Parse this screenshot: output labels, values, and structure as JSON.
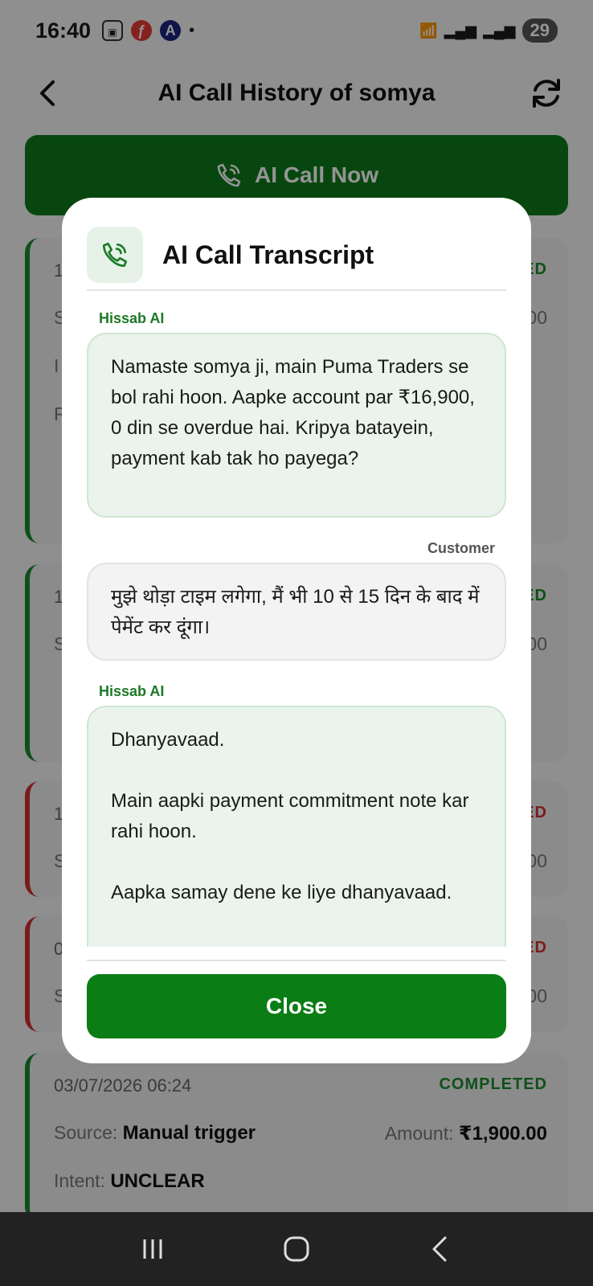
{
  "status_bar": {
    "time": "16:40",
    "battery": "29"
  },
  "header": {
    "title": "AI Call History of somya"
  },
  "call_now": {
    "label": "AI Call Now"
  },
  "cards": [
    {
      "date": "1",
      "status": "ED",
      "source_initial": "S",
      "amount_tail": "00",
      "intent_initial": "I",
      "extra_initial": "R"
    },
    {
      "date": "1",
      "status": "ED",
      "source_initial": "S",
      "amount_tail": "00"
    },
    {
      "date": "1",
      "status": "ED",
      "source_initial": "S",
      "amount_tail": "00"
    },
    {
      "date": "0",
      "status": "ED",
      "source_initial": "S",
      "amount_tail": "00"
    },
    {
      "date": "03/07/2026 06:24",
      "status": "COMPLETED",
      "source_label": "Source:",
      "source": "Manual trigger",
      "amount_label": "Amount:",
      "amount": "₹1,900.00",
      "intent_label": "Intent:",
      "intent": "UNCLEAR"
    }
  ],
  "dialog": {
    "title": "AI Call Transcript",
    "messages": [
      {
        "speaker": "Hissab AI",
        "text": "Namaste somya ji, main Puma Traders se bol rahi hoon. Aapke account par ₹16,900, 0 din se overdue hai. Kripya batayein, payment kab tak ho payega?"
      },
      {
        "speaker": "Customer",
        "text": "मुझे थोड़ा टाइम लगेगा, मैं भी 10 से 15 दिन के बाद में पेमेंट कर दूंगा।"
      },
      {
        "speaker": "Hissab AI",
        "text": "Dhanyavaad.\n\nMain aapki payment commitment note kar rahi hoon.\n\nAapka samay dene ke liye dhanyavaad."
      }
    ],
    "close_label": "Close"
  },
  "colors": {
    "brand_green": "#0a7d14",
    "failed_red": "#d32f2f",
    "ai_bubble": "#eaf4ec"
  },
  "icons": [
    "back-arrow-icon",
    "refresh-icon",
    "phone-call-icon",
    "nav-recents-icon",
    "nav-home-icon",
    "nav-back-icon"
  ]
}
